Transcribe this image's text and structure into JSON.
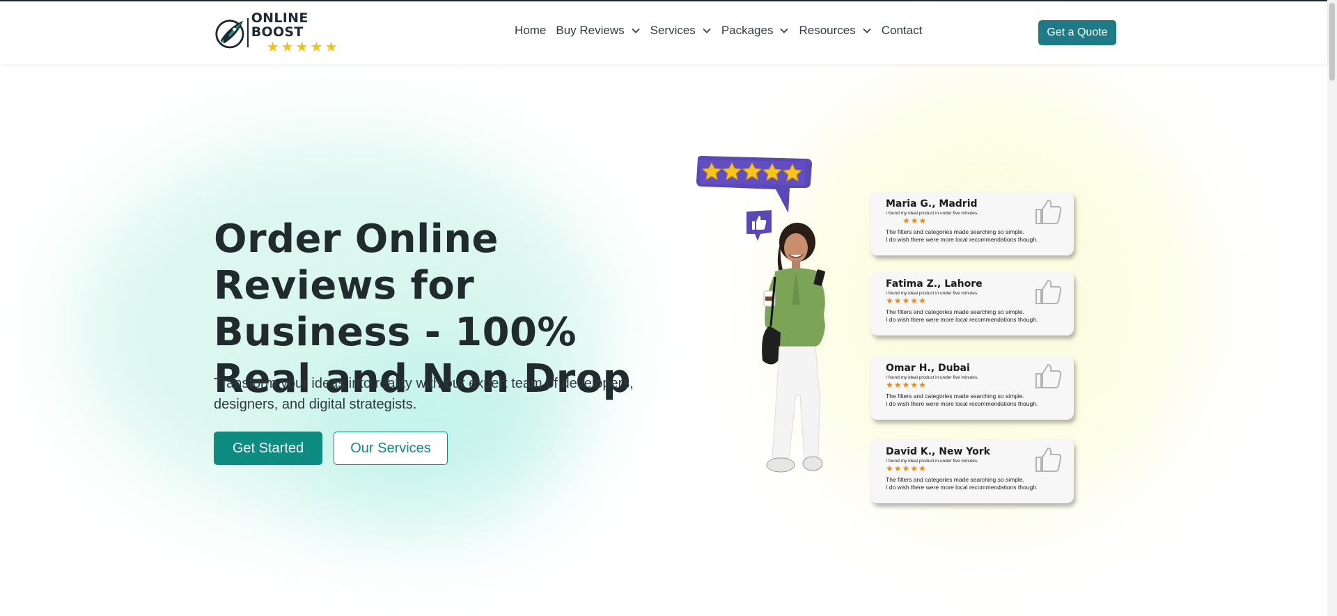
{
  "brand": {
    "name": "ONLINE BOOST",
    "star_count": 5,
    "colors": {
      "primary": "#0e8c82",
      "quote": "#1d7a86",
      "dark": "#1e2a33",
      "star": "#f5c010",
      "card_star": "#ef8a15"
    }
  },
  "nav": {
    "items": [
      {
        "label": "Home",
        "dropdown": false
      },
      {
        "label": "Buy Reviews",
        "dropdown": true
      },
      {
        "label": "Services",
        "dropdown": true
      },
      {
        "label": "Packages",
        "dropdown": true
      },
      {
        "label": "Resources",
        "dropdown": true
      },
      {
        "label": "Contact",
        "dropdown": false
      }
    ],
    "quote_label": "Get a Quote"
  },
  "hero": {
    "title": "Order Online Reviews for Business - 100% Real and Non Drop",
    "subtitle": "Transform your ideas into reality with our expert team of developers, designers, and digital strategists.",
    "primary_label": "Get Started",
    "secondary_label": "Our Services"
  },
  "reviews": [
    {
      "name": "Maria G., Madrid",
      "tagline": "I found my ideal product in under five minutes.",
      "rating": 3,
      "body": "The filters and categories made searching so simple.\nI do wish there were more local recommendations though."
    },
    {
      "name": "Fatima Z., Lahore",
      "tagline": "I found my ideal product in under five minutes.",
      "rating": 5,
      "body": "The filters and categories made searching so simple.\nI do wish there were more local recommendations though."
    },
    {
      "name": "Omar H., Dubai",
      "tagline": "I found my ideal product in under five minutes.",
      "rating": 5,
      "body": "The filters and categories made searching so simple.\nI do wish there were more local recommendations though."
    },
    {
      "name": "David K., New York",
      "tagline": "I found my ideal product in under five minutes.",
      "rating": 5,
      "body": "The filters and categories made searching so simple.\nI do wish there were more local recommendations though."
    }
  ]
}
